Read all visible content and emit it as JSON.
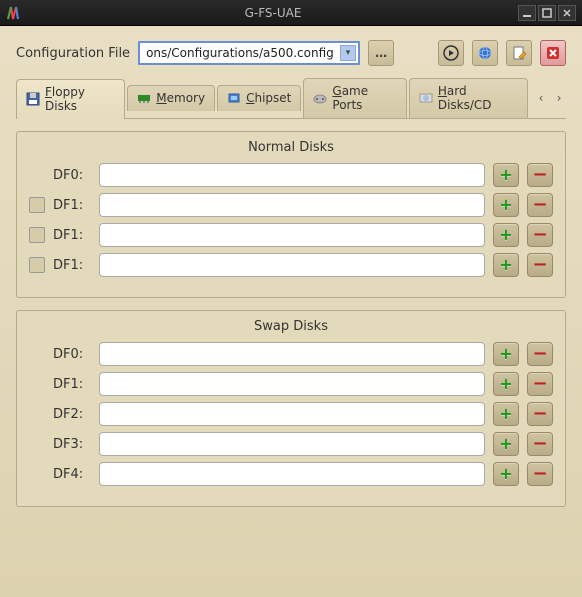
{
  "window": {
    "title": "G-FS-UAE"
  },
  "config": {
    "label": "Configuration File",
    "value": "ons/Configurations/a500.config"
  },
  "tabs": {
    "floppy": "Floppy Disks",
    "memory": "Memory",
    "chipset": "Chipset",
    "gameports": "Game Ports",
    "harddisks": "Hard Disks/CD"
  },
  "normal": {
    "title": "Normal Disks",
    "rows": [
      {
        "label": "DF0:",
        "value": ""
      },
      {
        "label": "DF1:",
        "value": ""
      },
      {
        "label": "DF1:",
        "value": ""
      },
      {
        "label": "DF1:",
        "value": ""
      }
    ]
  },
  "swap": {
    "title": "Swap Disks",
    "rows": [
      {
        "label": "DF0:",
        "value": ""
      },
      {
        "label": "DF1:",
        "value": ""
      },
      {
        "label": "DF2:",
        "value": ""
      },
      {
        "label": "DF3:",
        "value": ""
      },
      {
        "label": "DF4:",
        "value": ""
      }
    ]
  }
}
